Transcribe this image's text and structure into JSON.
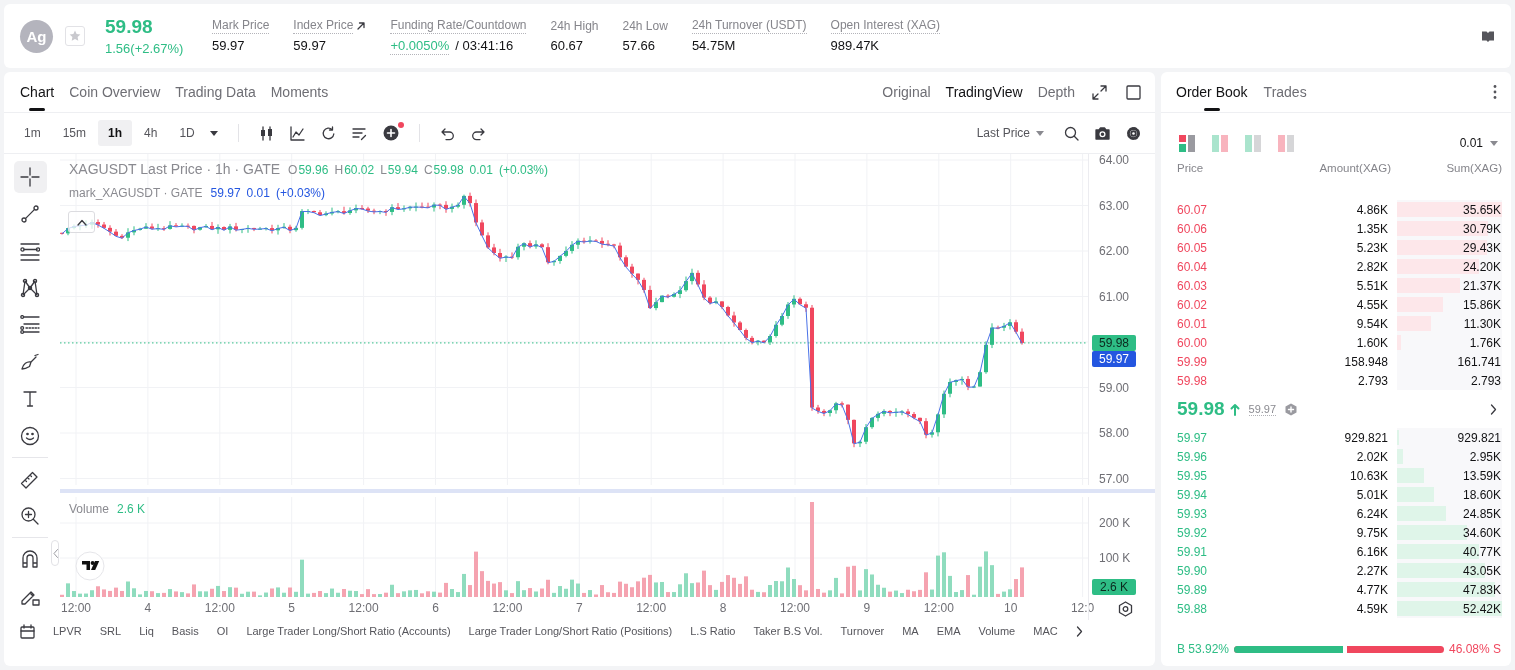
{
  "ticker": {
    "symbol": "Ag",
    "favorite": false,
    "price": "59.98",
    "change": "1.56(+2.67%)",
    "rising": true,
    "stats": [
      {
        "label": "Mark Price",
        "value": "59.97",
        "kind": "plain",
        "underlined": true
      },
      {
        "label": "Index Price",
        "value": "59.97",
        "kind": "link",
        "underlined": true
      },
      {
        "label": "Funding Rate/Countdown",
        "value": "+0.0050%",
        "countdown": "/ 03:41:16",
        "kind": "rate",
        "underlined": true
      },
      {
        "label": "24h High",
        "value": "60.67",
        "kind": "plain",
        "underlined": false
      },
      {
        "label": "24h Low",
        "value": "57.66",
        "kind": "plain",
        "underlined": false
      },
      {
        "label": "24h Turnover (USDT)",
        "value": "54.75M",
        "kind": "plain",
        "underlined": true
      },
      {
        "label": "Open Interest (XAG)",
        "value": "989.47K",
        "kind": "plain",
        "underlined": true
      }
    ]
  },
  "chart": {
    "tabs": [
      {
        "label": "Chart",
        "selected": true
      },
      {
        "label": "Coin Overview",
        "selected": false
      },
      {
        "label": "Trading Data",
        "selected": false
      },
      {
        "label": "Moments",
        "selected": false
      }
    ],
    "views": [
      {
        "label": "Original",
        "selected": false
      },
      {
        "label": "TradingView",
        "selected": true
      },
      {
        "label": "Depth",
        "selected": false
      }
    ],
    "intervals": [
      {
        "label": "1m",
        "selected": false
      },
      {
        "label": "15m",
        "selected": false
      },
      {
        "label": "1h",
        "selected": true
      },
      {
        "label": "4h",
        "selected": false
      },
      {
        "label": "1D",
        "selected": false
      }
    ],
    "price_source": "Last Price",
    "drawing_tools": [
      {
        "kind": "crosshair",
        "selected": true
      },
      {
        "kind": "trend-line",
        "selected": false
      },
      {
        "kind": "parallel-lines",
        "selected": false
      },
      {
        "kind": "pattern",
        "selected": false
      },
      {
        "kind": "fib",
        "selected": false
      },
      {
        "kind": "brush",
        "selected": false
      },
      {
        "kind": "text",
        "selected": false
      },
      {
        "kind": "emoji",
        "selected": false
      },
      {
        "kind": "ruler",
        "selected": false
      },
      {
        "kind": "zoom",
        "selected": false
      },
      {
        "kind": "magnet",
        "selected": false
      },
      {
        "kind": "lock",
        "selected": false
      }
    ],
    "legend": {
      "title": "XAGUSDT Last Price · 1h · GATE",
      "rising": true,
      "ohlc": [
        {
          "key": "O",
          "value": "59.96"
        },
        {
          "key": "H",
          "value": "60.02"
        },
        {
          "key": "L",
          "value": "59.94"
        },
        {
          "key": "C",
          "value": "59.98"
        }
      ],
      "change": "0.01",
      "change_pct": "(+0.03%)"
    },
    "mark_legend": {
      "title": "mark_XAGUSDT · GATE",
      "price": "59.97",
      "change": "0.01",
      "change_pct": "(+0.03%)"
    },
    "price_axis": [
      "64.00",
      "63.00",
      "62.00",
      "61.00",
      "59.00",
      "58.00",
      "57.00"
    ],
    "last_price_tag": "59.98",
    "mark_price_tag": "59.97",
    "volume": {
      "title": "Volume",
      "value": "2.6 K",
      "axis": [
        "200 K",
        "100 K"
      ],
      "tag": "2.6 K"
    },
    "time_axis": [
      "12:00",
      "4",
      "12:00",
      "5",
      "12:00",
      "6",
      "12:00",
      "7",
      "12:00",
      "8",
      "12:00",
      "9",
      "12:00",
      "10",
      "12:0"
    ],
    "indicators": [
      "LPVR",
      "SRL",
      "Liq",
      "Basis",
      "OI",
      "Large Trader Long/Short Ratio (Accounts)",
      "Large Trader Long/Short Ratio (Positions)",
      "L.S Ratio",
      "Taker B.S Vol.",
      "Turnover",
      "MA",
      "EMA",
      "Volume",
      "MAC"
    ]
  },
  "order_book": {
    "tabs": [
      {
        "label": "Order Book",
        "selected": true
      },
      {
        "label": "Trades",
        "selected": false
      }
    ],
    "layouts": [
      {
        "kind": "split",
        "selected": true
      },
      {
        "kind": "pair",
        "selected": false
      },
      {
        "kind": "bids",
        "selected": false
      },
      {
        "kind": "asks",
        "selected": false
      }
    ],
    "precision": "0.01",
    "columns": [
      "Price",
      "Amount(XAG)",
      "Sum(XAG)"
    ],
    "asks": [
      {
        "price": "60.07",
        "amount": "4.86K",
        "sum": "35.65K",
        "level": 1.0
      },
      {
        "price": "60.06",
        "amount": "1.35K",
        "sum": "30.79K",
        "level": 0.87
      },
      {
        "price": "60.05",
        "amount": "5.23K",
        "sum": "29.43K",
        "level": 0.86
      },
      {
        "price": "60.04",
        "amount": "2.82K",
        "sum": "24.20K",
        "level": 0.78
      },
      {
        "price": "60.03",
        "amount": "5.51K",
        "sum": "21.37K",
        "level": 0.6
      },
      {
        "price": "60.02",
        "amount": "4.55K",
        "sum": "15.86K",
        "level": 0.44
      },
      {
        "price": "60.01",
        "amount": "9.54K",
        "sum": "11.30K",
        "level": 0.32
      },
      {
        "price": "60.00",
        "amount": "1.60K",
        "sum": "1.76K",
        "level": 0.04
      },
      {
        "price": "59.99",
        "amount": "158.948",
        "sum": "161.741"
      },
      {
        "price": "59.98",
        "amount": "2.793",
        "sum": "2.793"
      }
    ],
    "last_price": "59.98",
    "rising": true,
    "mark_price": "59.97",
    "bids": [
      {
        "price": "59.97",
        "amount": "929.821",
        "sum": "929.821",
        "level": 0.02
      },
      {
        "price": "59.96",
        "amount": "2.02K",
        "sum": "2.95K",
        "level": 0.06
      },
      {
        "price": "59.95",
        "amount": "10.63K",
        "sum": "13.59K",
        "level": 0.26
      },
      {
        "price": "59.94",
        "amount": "5.01K",
        "sum": "18.60K",
        "level": 0.35
      },
      {
        "price": "59.93",
        "amount": "6.24K",
        "sum": "24.85K",
        "level": 0.47
      },
      {
        "price": "59.92",
        "amount": "9.75K",
        "sum": "34.60K",
        "level": 0.67
      },
      {
        "price": "59.91",
        "amount": "6.16K",
        "sum": "40.77K",
        "level": 0.78
      },
      {
        "price": "59.90",
        "amount": "2.27K",
        "sum": "43.05K",
        "level": 0.84
      },
      {
        "price": "59.89",
        "amount": "4.77K",
        "sum": "47.83K",
        "level": 0.93
      },
      {
        "price": "59.88",
        "amount": "4.59K",
        "sum": "52.42K",
        "level": 1.0
      }
    ],
    "ratio": {
      "buy": "B 53.92%",
      "sell": "46.08% S",
      "level": 0.5392
    }
  }
}
